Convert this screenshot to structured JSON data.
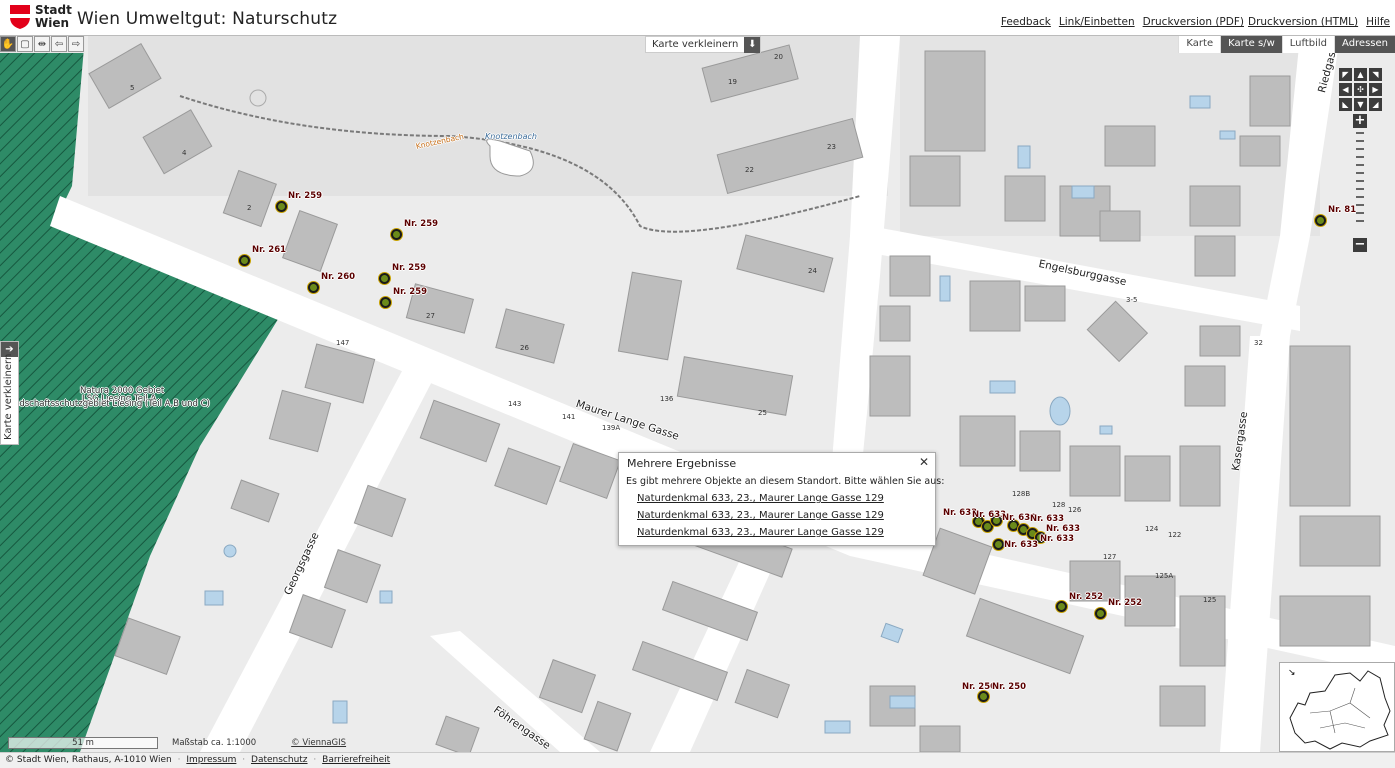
{
  "header": {
    "logo_text_line1": "Stadt",
    "logo_text_line2": "Wien",
    "title": "Wien Umweltgut: Naturschutz",
    "links": [
      "Feedback",
      "Link/Einbetten",
      "Druckversion (PDF)",
      "Druckversion (HTML)",
      "Hilfe"
    ]
  },
  "toolbar": {
    "buttons": [
      "hand-icon",
      "select-rectangle-icon",
      "measure-icon",
      "back-arrow-icon",
      "forward-arrow-icon"
    ],
    "shrink_top_label": "Karte verkleinern"
  },
  "map_tabs": {
    "items": [
      "Karte",
      "Karte s/w",
      "Luftbild",
      "Adressen"
    ],
    "selected": [
      "Karte s/w",
      "Adressen"
    ]
  },
  "side_tab": {
    "label": "Karte verkleinern"
  },
  "popup": {
    "title": "Mehrere Ergebnisse",
    "message": "Es gibt mehrere Objekte an diesem Standort. Bitte wählen Sie aus:",
    "results": [
      "Naturdenkmal 633, 23., Maurer Lange Gasse 129",
      "Naturdenkmal 633, 23., Maurer Lange Gasse 129",
      "Naturdenkmal 633, 23., Maurer Lange Gasse 129"
    ]
  },
  "map": {
    "streets": [
      "Maurer Lange Gasse",
      "Engelsburggasse",
      "Kasergasse",
      "Georgsgasse",
      "Föhrengasse",
      "Riedgas",
      "Knotzenbach",
      "Knotzenbach"
    ],
    "area_label_1": "LSG Liesing Teil A",
    "area_label_2": "Landschaftsschutzgebiet Liesing (Teil A,B und C)",
    "area_label_3": "Natura 2000 Gebiet",
    "markers": [
      "Nr. 259",
      "Nr. 259",
      "Nr. 261",
      "Nr. 260",
      "Nr. 259",
      "Nr. 259",
      "Nr. 81",
      "Nr. 633",
      "Nr. 633",
      "Nr. 633",
      "Nr. 633",
      "Nr. 633",
      "Nr. 633",
      "Nr. 633",
      "Nr. 252",
      "Nr. 252",
      "Nr. 250",
      "Nr. 250"
    ],
    "house_numbers": [
      "5",
      "4",
      "2",
      "2",
      "27",
      "26",
      "147",
      "145",
      "143",
      "141",
      "139A",
      "136",
      "25",
      "24",
      "22",
      "23",
      "20",
      "19",
      "1",
      "11",
      "9",
      "7",
      "3-5",
      "2",
      "1",
      "4A",
      "128B",
      "128",
      "126",
      "124",
      "122",
      "127",
      "125A",
      "125",
      "38",
      "36",
      "32",
      "34",
      "12",
      "10",
      "8",
      "6",
      "4",
      "3",
      "5",
      "7",
      "2A"
    ],
    "zoom_colors": {
      "marker_fill": "#6b8a1a",
      "marker_ring": "#c8a200",
      "protected_area": "#2e8b67",
      "label_color": "#5b0000"
    }
  },
  "scalebar": {
    "distance": "51 m",
    "scale": "Maßstab ca. 1:1000",
    "copyright": "© ViennaGIS"
  },
  "footer": {
    "text": "© Stadt Wien, Rathaus, A-1010 Wien",
    "links": [
      "Impressum",
      "Datenschutz",
      "Barrierefreiheit"
    ]
  }
}
